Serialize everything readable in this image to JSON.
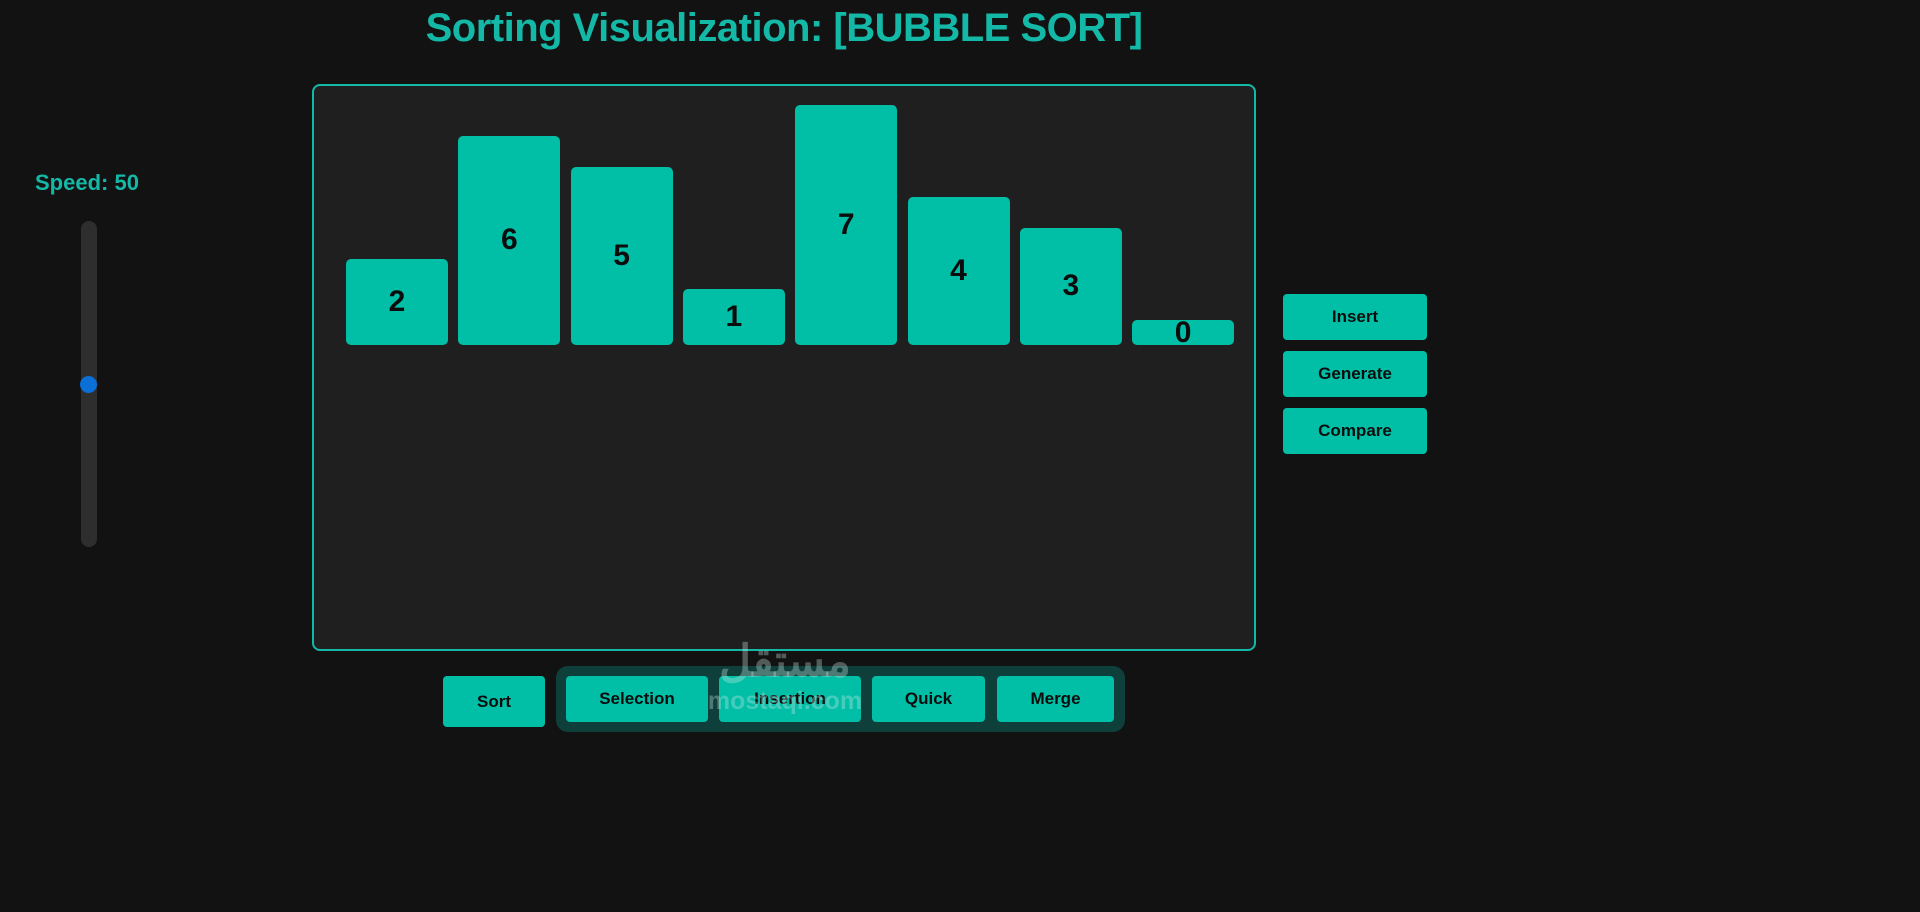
{
  "title": "Sorting Visualization: [BUBBLE SORT]",
  "speed": {
    "label": "Speed: 50",
    "value": 50,
    "min": 0,
    "max": 100
  },
  "bars": [
    2,
    6,
    5,
    1,
    7,
    4,
    3,
    0
  ],
  "bar_scale_max": 7,
  "side_buttons": {
    "insert": "Insert",
    "generate": "Generate",
    "compare": "Compare"
  },
  "sort_button": "Sort",
  "algorithms": [
    "Selection",
    "Insertion",
    "Quick",
    "Merge"
  ],
  "watermark": {
    "arabic": "مستقل",
    "latin": "mostaqi.com"
  },
  "colors": {
    "accent": "#14b8a6",
    "bar": "#00bfa6",
    "background": "#121212",
    "canvas": "#1f1f1f",
    "slider_thumb": "#0a6fd6"
  }
}
